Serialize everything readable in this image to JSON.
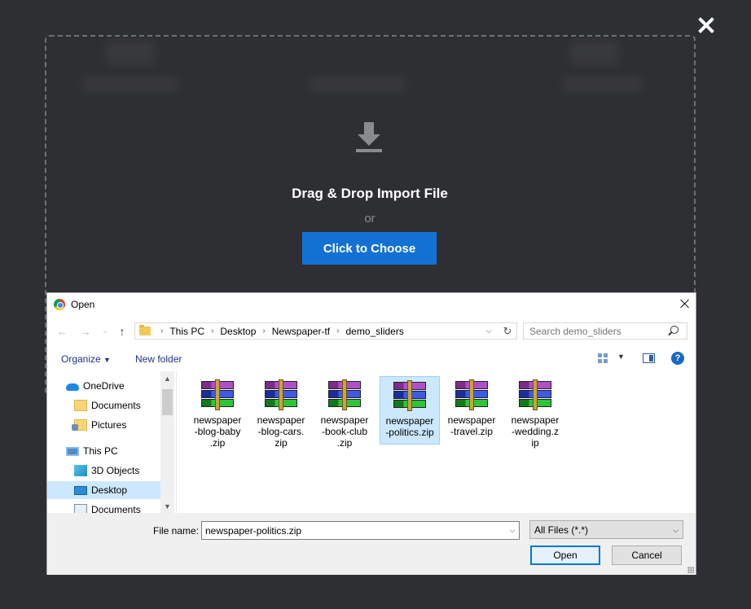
{
  "import_modal": {
    "drop_title": "Drag & Drop Import File",
    "or_text": "or",
    "choose_button": "Click to Choose"
  },
  "dialog": {
    "title": "Open",
    "breadcrumb": [
      "This PC",
      "Desktop",
      "Newspaper-tf",
      "demo_sliders"
    ],
    "search_placeholder": "Search demo_sliders",
    "toolbar": {
      "organize": "Organize",
      "new_folder": "New folder"
    },
    "tree": [
      {
        "label": "OneDrive",
        "icon": "cloud-icon"
      },
      {
        "label": "Documents",
        "icon": "folder-icon"
      },
      {
        "label": "Pictures",
        "icon": "pictures-icon"
      },
      {
        "label": "This PC",
        "icon": "computer-icon"
      },
      {
        "label": "3D Objects",
        "icon": "cube-icon"
      },
      {
        "label": "Desktop",
        "icon": "desktop-icon",
        "selected": true
      },
      {
        "label": "Documents",
        "icon": "documents-icon"
      }
    ],
    "files": [
      {
        "name": "newspaper-blog-baby.zip",
        "lines": [
          "newspaper",
          "-blog-baby",
          ".zip"
        ]
      },
      {
        "name": "newspaper-blog-cars.zip",
        "lines": [
          "newspaper",
          "-blog-cars.",
          "zip"
        ]
      },
      {
        "name": "newspaper-book-club.zip",
        "lines": [
          "newspaper",
          "-book-club",
          ".zip"
        ]
      },
      {
        "name": "newspaper-politics.zip",
        "lines": [
          "newspaper",
          "-politics.zip"
        ],
        "selected": true
      },
      {
        "name": "newspaper-travel.zip",
        "lines": [
          "newspaper",
          "-travel.zip"
        ]
      },
      {
        "name": "newspaper-wedding.zip",
        "lines": [
          "newspaper",
          "-wedding.z",
          "ip"
        ]
      }
    ],
    "file_name_label": "File name:",
    "file_name_value": "newspaper-politics.zip",
    "filter": "All Files (*.*)",
    "open_button": "Open",
    "cancel_button": "Cancel"
  },
  "colors": {
    "accent": "#1471d4",
    "selection": "#cce8ff"
  }
}
